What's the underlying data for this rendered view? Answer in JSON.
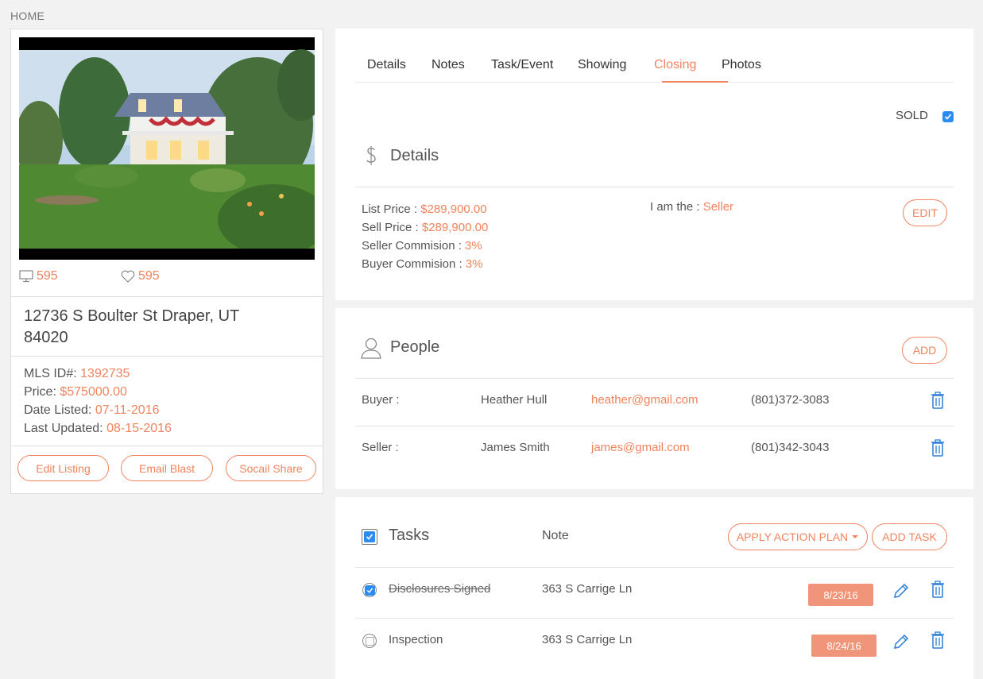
{
  "breadcrumb": "HOME",
  "listing": {
    "views": "595",
    "likes": "595",
    "address": "12736 S Boulter St Draper, UT 84020",
    "mls_label": "MLS ID#:",
    "mls_value": "1392735",
    "price_label": "Price:",
    "price_value": "$575000.00",
    "listed_label": "Date Listed:",
    "listed_value": "07-11-2016",
    "updated_label": "Last Updated:",
    "updated_value": "08-15-2016",
    "buttons": {
      "edit": "Edit Listing",
      "email": "Email Blast",
      "share": "Socail Share"
    }
  },
  "tabs": [
    "Details",
    "Notes",
    "Task/Event",
    "Showing",
    "Closing",
    "Photos"
  ],
  "active_tab": "Closing",
  "sold": {
    "label": "SOLD",
    "checked": true
  },
  "details": {
    "title": "Details",
    "list_price_label": "List Price :",
    "list_price": "$289,900.00",
    "sell_price_label": "Sell Price :",
    "sell_price": "$289,900.00",
    "seller_comm_label": "Seller Commision :",
    "seller_comm": "3%",
    "buyer_comm_label": "Buyer Commision :",
    "buyer_comm": "3%",
    "role_label": "I am the :",
    "role": "Seller",
    "edit_label": "EDIT"
  },
  "people": {
    "title": "People",
    "add_label": "ADD",
    "rows": [
      {
        "role": "Buyer :",
        "name": "Heather Hull",
        "email": "heather@gmail.com",
        "phone": "(801)372-3083"
      },
      {
        "role": "Seller :",
        "name": "James Smith",
        "email": "james@gmail.com",
        "phone": "(801)342-3043"
      }
    ]
  },
  "tasks": {
    "title": "Tasks",
    "note_header": "Note",
    "apply_label": "APPLY ACTION PLAN",
    "add_label": "ADD TASK",
    "rows": [
      {
        "name": "Disclosures Signed",
        "note": "363 S Carrige Ln",
        "date": "8/23/16",
        "done": true
      },
      {
        "name": "Inspection",
        "note": "363 S Carrige Ln",
        "date": "8/24/16",
        "done": false
      }
    ]
  },
  "colors": {
    "accent": "#f0845e",
    "check": "#2d8cf0",
    "trash": "#2d7fd6",
    "badge": "#f0957a"
  }
}
